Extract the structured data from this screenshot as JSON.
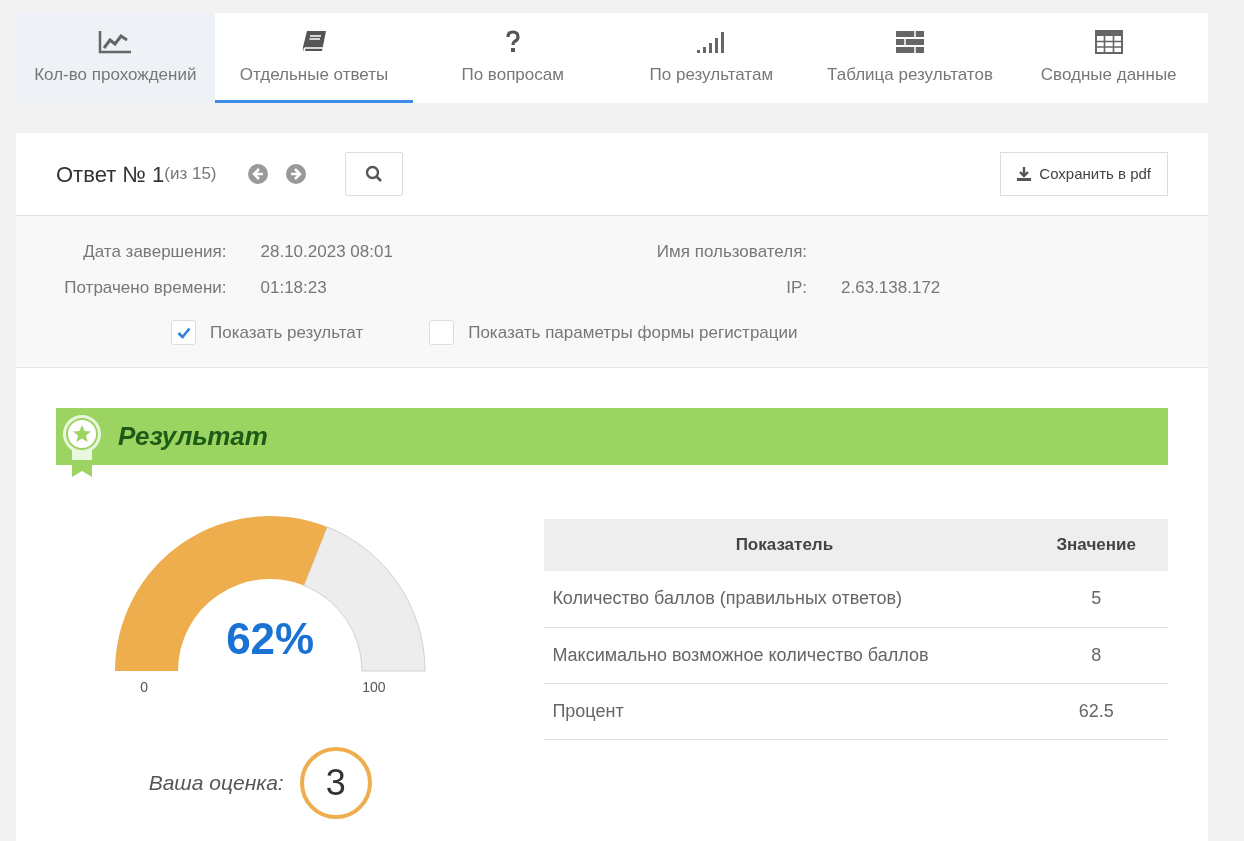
{
  "tabs": [
    {
      "label": "Кол-во прохождений",
      "kind": "chart",
      "selected": false,
      "hovered": true
    },
    {
      "label": "Отдельные ответы",
      "kind": "book",
      "selected": true,
      "hovered": false
    },
    {
      "label": "По вопросам",
      "kind": "question",
      "selected": false,
      "hovered": false
    },
    {
      "label": "По результатам",
      "kind": "bars",
      "selected": false,
      "hovered": false
    },
    {
      "label": "Таблица результатов",
      "kind": "rows",
      "selected": false,
      "hovered": false
    },
    {
      "label": "Сводные данные",
      "kind": "grid",
      "selected": false,
      "hovered": false
    }
  ],
  "answer": {
    "title": "Ответ № 1",
    "count": "(из 15)",
    "save_button": "Сохранить в pdf"
  },
  "info": {
    "left": [
      {
        "label": "Дата завершения:",
        "value": "28.10.2023 08:01"
      },
      {
        "label": "Потрачено времени:",
        "value": "01:18:23"
      }
    ],
    "right": [
      {
        "label": "Имя пользователя:"
      },
      {
        "label": "IP:",
        "value": "2.63.138.172"
      }
    ],
    "options": [
      {
        "label": "Показать результат",
        "checked": true
      },
      {
        "label": "Показать параметры формы регистрации",
        "checked": false
      }
    ]
  },
  "result": {
    "title": "Результат",
    "gauge": {
      "level": 0.62,
      "reading": "62%",
      "min": "0",
      "max": "100"
    },
    "grade_label": "Ваша оценка:",
    "grade": "3",
    "table": {
      "columns": [
        "Показатель",
        "Значение"
      ],
      "rows": [
        [
          "Количество баллов (правильных ответов)",
          "5"
        ],
        [
          "Максимально возможное количество баллов",
          "8"
        ],
        [
          "Процент",
          "62.5"
        ]
      ]
    }
  }
}
